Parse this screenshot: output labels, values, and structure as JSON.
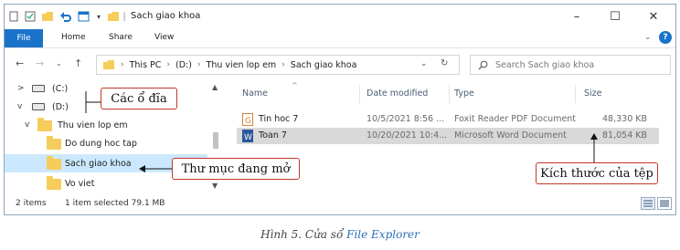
{
  "window": {
    "title": "Sach giao khoa",
    "controls": {
      "minimize": "–",
      "maximize": "☐",
      "close": "✕"
    }
  },
  "ribbon": {
    "tabs": [
      "File",
      "Home",
      "Share",
      "View"
    ]
  },
  "address": {
    "crumbs": [
      "This PC",
      "(D:)",
      "Thu vien lop em",
      "Sach giao khoa"
    ],
    "search_placeholder": "Search Sach giao khoa"
  },
  "nav_tree": [
    {
      "label": "(C:)",
      "type": "drive",
      "chevron": ">",
      "selected": false
    },
    {
      "label": "(D:)",
      "type": "drive",
      "chevron": "v",
      "selected": false
    },
    {
      "label": "Thu vien lop em",
      "type": "folder",
      "chevron": "v",
      "selected": false
    },
    {
      "label": "Do dung hoc tap",
      "type": "folder",
      "chevron": "",
      "selected": false
    },
    {
      "label": "Sach giao khoa",
      "type": "folder",
      "chevron": "",
      "selected": true
    },
    {
      "label": "Vo viet",
      "type": "folder",
      "chevron": "",
      "selected": false
    }
  ],
  "file_list": {
    "columns": [
      "Name",
      "Date modified",
      "Type",
      "Size"
    ],
    "rows": [
      {
        "name": "Tin hoc 7",
        "date": "10/5/2021 8:56 ...",
        "type": "Foxit Reader PDF Document",
        "size": "48,330 KB",
        "icon": "pdf-file-icon",
        "selected": false
      },
      {
        "name": "Toan 7",
        "date": "10/20/2021 10:4...",
        "type": "Microsoft Word Document",
        "size": "81,054 KB",
        "icon": "word-file-icon",
        "selected": true
      }
    ]
  },
  "status": {
    "items": "2 items",
    "selection": "1 item selected  79.1 MB"
  },
  "annotations": {
    "drives": "Các ổ đĩa",
    "open_folder": "Thư mục đang mở",
    "file_size": "Kích thước của tệp"
  },
  "caption": {
    "prefix": "Hình 5. Cửa sổ ",
    "highlight": "File Explorer"
  },
  "colors": {
    "accent": "#1a73c9",
    "selection": "#cce8ff",
    "callout_border": "#c0392b",
    "folder": "#f6cc5a"
  }
}
